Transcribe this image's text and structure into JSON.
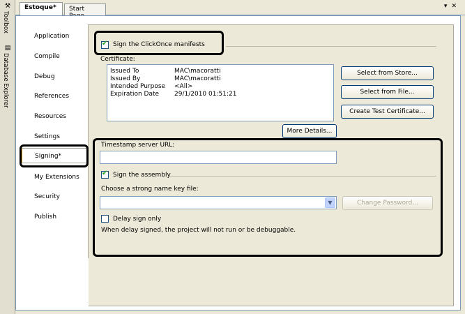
{
  "side_strip": {
    "toolbox_label": "Toolbox",
    "database_explorer_label": "Database Explorer"
  },
  "tabs": {
    "active_label": "Estoque*",
    "start_page_label": "Start Page"
  },
  "nav": {
    "items": [
      "Application",
      "Compile",
      "Debug",
      "References",
      "Resources",
      "Settings",
      "Signing*",
      "My Extensions",
      "Security",
      "Publish"
    ]
  },
  "signing": {
    "sign_clickonce_label": "Sign the ClickOnce manifests",
    "certificate_label": "Certificate:",
    "cert_fields": [
      {
        "key": "Issued To",
        "value": "MAC\\macoratti"
      },
      {
        "key": "Issued By",
        "value": "MAC\\macoratti"
      },
      {
        "key": "Intended Purpose",
        "value": "<All>"
      },
      {
        "key": "Expiration Date",
        "value": "29/1/2010 01:51:21"
      }
    ],
    "select_from_store": "Select from Store...",
    "select_from_file": "Select from File...",
    "create_test_cert": "Create Test Certificate...",
    "more_details": "More Details...",
    "timestamp_label": "Timestamp server URL:",
    "timestamp_value": "",
    "sign_assembly_label": "Sign the assembly",
    "key_file_label": "Choose a strong name key file:",
    "key_file_value": "",
    "change_password": "Change Password...",
    "delay_sign_label": "Delay sign only",
    "delay_note": "When delay signed, the project will not run or be debuggable."
  }
}
